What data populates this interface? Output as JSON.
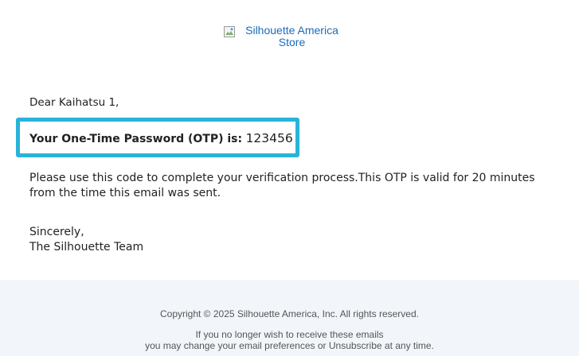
{
  "header": {
    "logo_alt": "Silhouette America Store"
  },
  "message": {
    "greeting": "Dear Kaihatsu 1,",
    "otp_label": "Your One-Time Password (OTP) is:",
    "otp_code": "123456",
    "instructions": "Please use this code to complete your verification process.This OTP is valid for 20 minutes from the time this email was sent.",
    "signoff": "Sincerely,",
    "signature": "The Silhouette Team"
  },
  "footer": {
    "copyright": "Copyright © 2025 Silhouette America, Inc. All rights reserved.",
    "unsubscribe_line1": "If you no longer wish to receive these emails",
    "unsubscribe_line2": "you may change your email preferences or Unsubscribe at any time."
  },
  "colors": {
    "highlight_border": "#29b3d9",
    "link_blue": "#1a6bb8",
    "footer_bg": "#f2f6fa"
  },
  "icons": {
    "logo_placeholder": "broken-image-icon"
  }
}
